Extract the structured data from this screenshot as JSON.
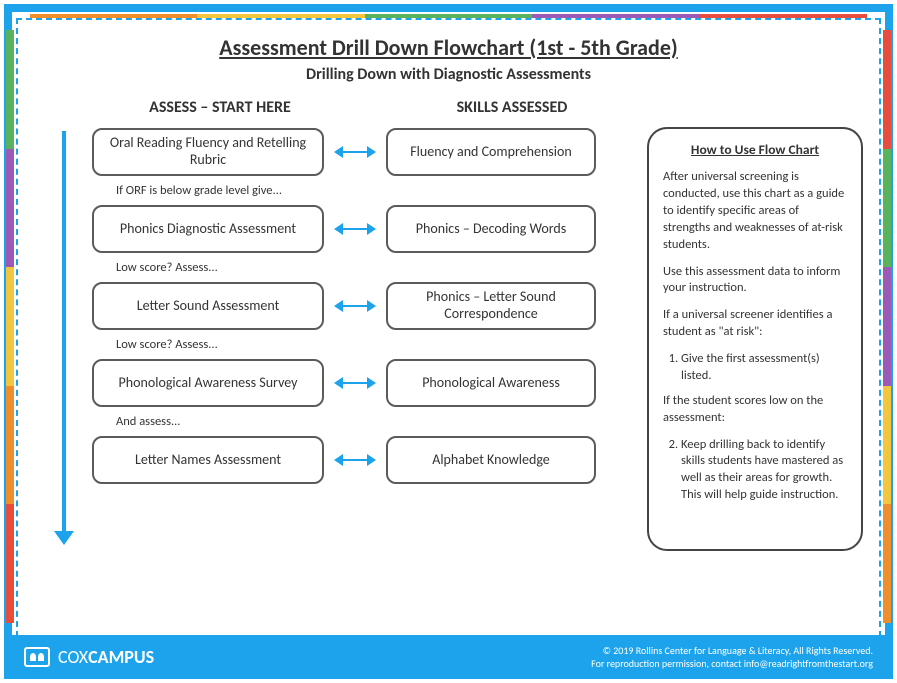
{
  "title": "Assessment Drill Down Flowchart (1st - 5th Grade)",
  "subtitle": "Drilling Down with Diagnostic Assessments",
  "headers": {
    "assess": "ASSESS – START HERE",
    "skills": "SKILLS ASSESSED"
  },
  "rows": [
    {
      "assess": "Oral Reading Fluency and Retelling Rubric",
      "skill": "Fluency and Comprehension",
      "after": "If ORF is below grade level give..."
    },
    {
      "assess": "Phonics Diagnostic Assessment",
      "skill": "Phonics – Decoding Words",
      "after": "Low score? Assess..."
    },
    {
      "assess": "Letter Sound Assessment",
      "skill": "Phonics – Letter Sound Correspondence",
      "after": "Low score? Assess..."
    },
    {
      "assess": "Phonological Awareness Survey",
      "skill": "Phonological Awareness",
      "after": "And assess..."
    },
    {
      "assess": "Letter Names Assessment",
      "skill": "Alphabet Knowledge",
      "after": ""
    }
  ],
  "info": {
    "title": "How to Use Flow Chart",
    "p1": "After universal screening is conducted, use this chart as a guide to identify specific areas of strengths and weaknesses of at-risk students.",
    "p2": "Use this assessment data to inform your instruction.",
    "p3": "If a universal screener identifies a student as \"at risk\":",
    "li1": "Give the first assessment(s) listed.",
    "p4": "If the student scores low on the assessment:",
    "li2": "Keep drilling back to identify skills students have mastered as well as their areas for growth. This will help guide instruction."
  },
  "footer": {
    "brand_prefix": "COX",
    "brand_suffix": "CAMPUS",
    "copyright": "© 2019 Rollins Center for Language & Literacy, All Rights Reserved.",
    "contact": "For reproduction permission, contact info@readrightfromthestart.org"
  },
  "chart_data": {
    "type": "flowchart",
    "direction": "top-to-bottom",
    "nodes": [
      {
        "id": "a1",
        "col": "assess",
        "label": "Oral Reading Fluency and Retelling Rubric"
      },
      {
        "id": "s1",
        "col": "skill",
        "label": "Fluency and Comprehension"
      },
      {
        "id": "a2",
        "col": "assess",
        "label": "Phonics Diagnostic Assessment"
      },
      {
        "id": "s2",
        "col": "skill",
        "label": "Phonics – Decoding Words"
      },
      {
        "id": "a3",
        "col": "assess",
        "label": "Letter Sound Assessment"
      },
      {
        "id": "s3",
        "col": "skill",
        "label": "Phonics – Letter Sound Correspondence"
      },
      {
        "id": "a4",
        "col": "assess",
        "label": "Phonological Awareness Survey"
      },
      {
        "id": "s4",
        "col": "skill",
        "label": "Phonological Awareness"
      },
      {
        "id": "a5",
        "col": "assess",
        "label": "Letter Names Assessment"
      },
      {
        "id": "s5",
        "col": "skill",
        "label": "Alphabet Knowledge"
      }
    ],
    "edges": [
      {
        "from": "a1",
        "to": "s1",
        "type": "bidirectional"
      },
      {
        "from": "a2",
        "to": "s2",
        "type": "bidirectional"
      },
      {
        "from": "a3",
        "to": "s3",
        "type": "bidirectional"
      },
      {
        "from": "a4",
        "to": "s4",
        "type": "bidirectional"
      },
      {
        "from": "a5",
        "to": "s5",
        "type": "bidirectional"
      },
      {
        "from": "a1",
        "to": "a2",
        "type": "conditional",
        "label": "If ORF is below grade level give..."
      },
      {
        "from": "a2",
        "to": "a3",
        "type": "conditional",
        "label": "Low score? Assess..."
      },
      {
        "from": "a3",
        "to": "a4",
        "type": "conditional",
        "label": "Low score? Assess..."
      },
      {
        "from": "a4",
        "to": "a5",
        "type": "conditional",
        "label": "And assess..."
      }
    ]
  }
}
